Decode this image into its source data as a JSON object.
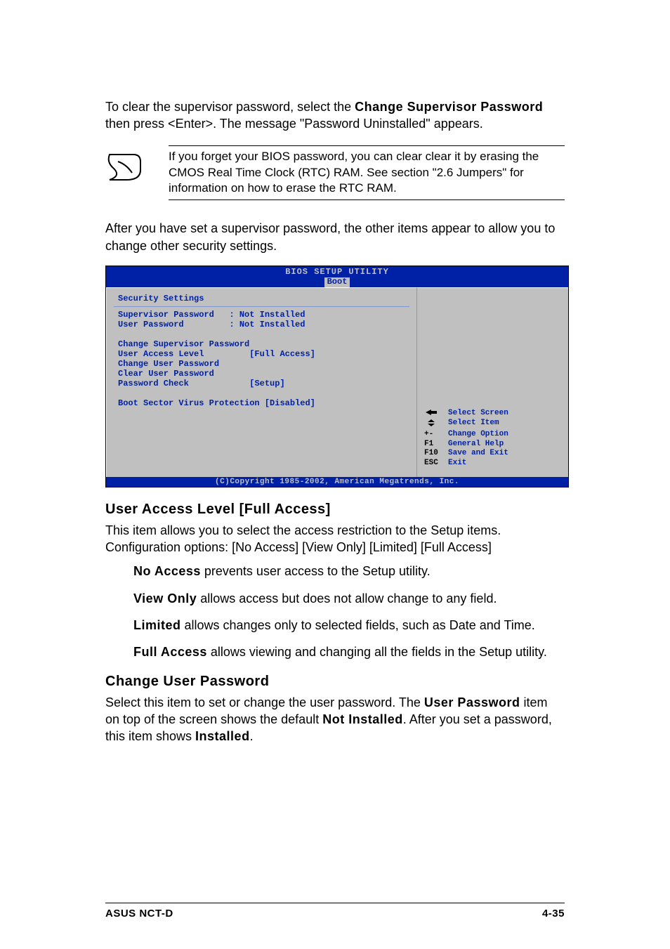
{
  "intro": {
    "pre": "To clear the supervisor password, select the ",
    "bold1": "Change Supervisor Password",
    "post": " then press <Enter>. The message \"Password Uninstalled\" appears."
  },
  "note": "If you forget your BIOS password, you can clear clear it by erasing the CMOS Real Time Clock (RTC) RAM. See section \"2.6  Jumpers\" for information on how to erase the RTC RAM.",
  "after_note": "After you have set a supervisor password, the other items appear to allow you to change other security settings.",
  "bios": {
    "title": "BIOS SETUP UTILITY",
    "tab": "Boot",
    "section": "Security Settings",
    "rows": {
      "sup_pw_label": "Supervisor Password",
      "sup_pw_val": ": Not Installed",
      "user_pw_label": "User Password",
      "user_pw_val": ": Not Installed",
      "change_sup": "Change Supervisor Password",
      "ual_label": "User Access Level",
      "ual_val": "[Full Access]",
      "change_user": "Change User Password",
      "clear_user": "Clear User Password",
      "pwcheck_label": "Password Check",
      "pwcheck_val": "[Setup]",
      "boot_label": "Boot Sector Virus Protection",
      "boot_val": "[Disabled]"
    },
    "help": {
      "arrow_lr": "Select Screen",
      "arrow_ud": "Select Item",
      "pm": "+-",
      "pm_d": "Change Option",
      "f1": "F1",
      "f1_d": "General Help",
      "f10": "F10",
      "f10_d": "Save and Exit",
      "esc": "ESC",
      "esc_d": "Exit"
    },
    "copyright": "(C)Copyright 1985-2002, American Megatrends, Inc."
  },
  "ual_heading": "User Access Level [Full Access]",
  "ual_desc": "This item allows you to select the access restriction to the Setup items. Configuration options: [No Access] [View Only] [Limited] [Full Access]",
  "opts": {
    "na_b": "No Access",
    "na_t": " prevents user access to the Setup utility.",
    "vo_b": "View Only",
    "vo_t": " allows access but does not allow change to any field.",
    "li_b": "Limited",
    "li_t": " allows changes only to selected fields, such as Date and Time.",
    "fa_b": "Full Access",
    "fa_t": " allows viewing and changing all the fields in the Setup utility."
  },
  "cup_heading": "Change User Password",
  "cup": {
    "t1": "Select this item to set or change the user password. The ",
    "b1": "User Password",
    "t2": " item on top of the screen shows the default ",
    "b2": "Not Installed",
    "t3": ". After you set a password, this item shows ",
    "b3": "Installed",
    "t4": "."
  },
  "footer": {
    "left": "ASUS NCT-D",
    "right": "4-35"
  }
}
